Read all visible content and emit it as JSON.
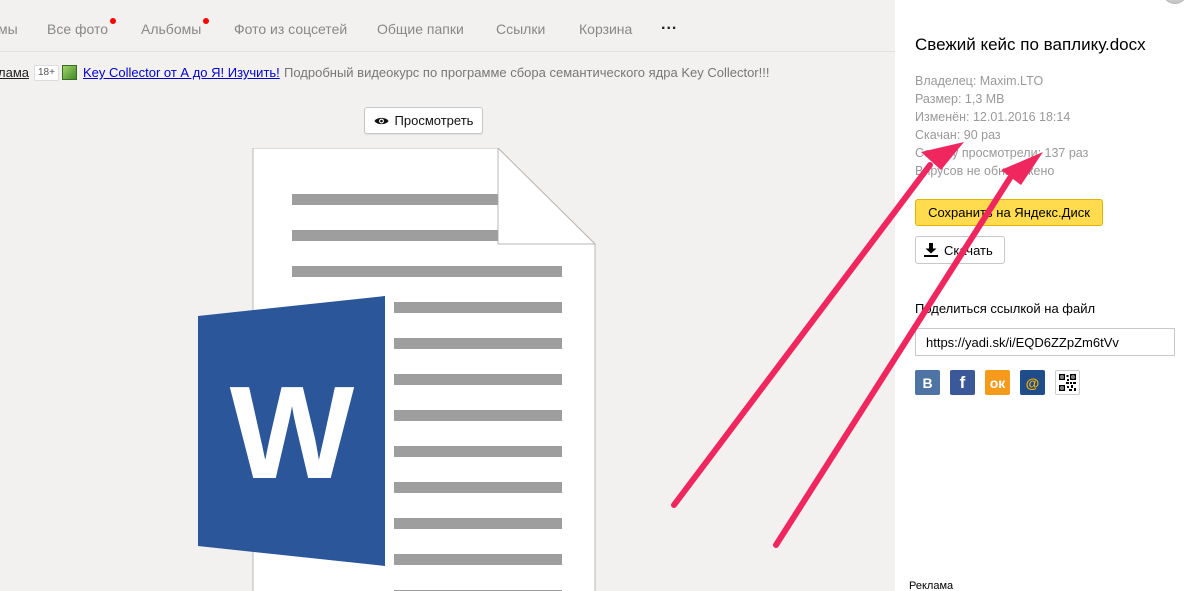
{
  "tabs": [
    {
      "label": "мы"
    },
    {
      "label": "Все фото"
    },
    {
      "label": "Альбомы"
    },
    {
      "label": "Фото из соцсетей"
    },
    {
      "label": "Общие папки"
    },
    {
      "label": "Ссылки"
    },
    {
      "label": "Корзина"
    }
  ],
  "more_label": "...",
  "ad": {
    "cut_label": "лама",
    "age": "18+",
    "link": "Key Collector от А до Я! Изучить!",
    "text": "Подробный видеокурс по программе сбора семантического ядра Key Collector!!!"
  },
  "preview": {
    "view_label": "Просмотреть",
    "icon": "eye-icon",
    "file_icon": "word-document-icon",
    "word_letter": "W"
  },
  "file": {
    "title": "Свежий кейс по ваплику.docx",
    "owner": "Владелец: Maxim.LTO",
    "size": "Размер: 1,3 MB",
    "modified": "Изменён: 12.01.2016 18:14",
    "downloaded": "Скачан: 90 раз",
    "views": "Ссылку просмотрели: 137 раз",
    "viruses": "Вирусов не обнаружено"
  },
  "actions": {
    "save_label": "Сохранить на Яндекс.Диск",
    "download_label": "Скачать"
  },
  "share": {
    "label": "Поделиться ссылкой на файл",
    "url": "https://yadi.sk/i/EQD6ZZpZm6tVv",
    "networks": [
      "В",
      "f",
      "ок",
      "@"
    ]
  },
  "footer": {
    "ads_label": "Реклама"
  },
  "colors": {
    "tab_dot": "#ff0000",
    "save_button": "#ffdb4d",
    "word_blue": "#2b579a",
    "arrow": "#f0265f",
    "ad_link": "#0000cc"
  }
}
